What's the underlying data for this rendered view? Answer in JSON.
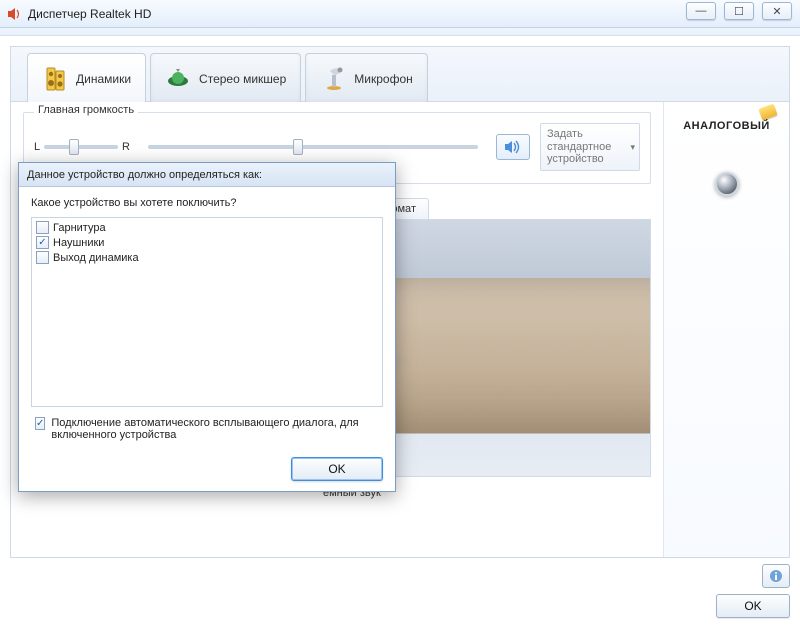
{
  "window": {
    "title": "Диспетчер Realtek HD"
  },
  "tabs": [
    {
      "label": "Динамики"
    },
    {
      "label": "Стерео микшер"
    },
    {
      "label": "Микрофон"
    }
  ],
  "volume": {
    "group_label": "Главная громкость",
    "balance_left": "L",
    "balance_right": "R"
  },
  "preset_button": "Задать стандартное устройство",
  "sub_tab": {
    "label_partial": "артный формат"
  },
  "caption_partial": "емный звук",
  "right_panel": {
    "label": "АНАЛОГОВЫЙ"
  },
  "bottom": {
    "ok": "OK"
  },
  "modal": {
    "title": "Данное устройство должно определяться как:",
    "question": "Какое устройство вы хотете поключить?",
    "options": [
      {
        "label": "Гарнитура",
        "checked": false
      },
      {
        "label": "Наушники",
        "checked": true
      },
      {
        "label": "Выход динамика",
        "checked": false
      }
    ],
    "auto_popup": "Подключение автоматического всплывающего диалога, для включенного устройства",
    "auto_popup_checked": true,
    "ok": "OK"
  }
}
